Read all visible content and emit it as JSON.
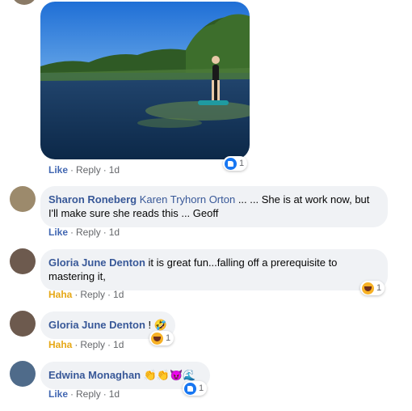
{
  "actions": {
    "like": "Like",
    "reply": "Reply",
    "haha": "Haha",
    "sep": "·"
  },
  "top_post": {
    "time": "1d",
    "reaction_count": "1"
  },
  "comments": [
    {
      "author": "Sharon Roneberg",
      "tagged": "Karen Tryhorn Orton",
      "text": " ... ... She is at work now, but I'll make sure she reads this ... Geoff",
      "reaction_label": "Like",
      "time": "1d"
    },
    {
      "author": "Gloria June Denton",
      "text": " it is great fun...falling off a prerequisite to mastering it,",
      "reaction_label": "Haha",
      "time": "1d",
      "reaction_count": "1"
    },
    {
      "author": "Gloria June Denton",
      "text": " ! 🤣",
      "reaction_label": "Haha",
      "time": "1d",
      "reaction_count": "1"
    },
    {
      "author": "Edwina Monaghan",
      "text": " 👏👏😈🌊",
      "reaction_label": "Like",
      "time": "1d",
      "reaction_count": "1"
    }
  ],
  "icons": {
    "like_reaction": "thumbs-up-icon",
    "haha_reaction": "haha-emoji-icon"
  }
}
